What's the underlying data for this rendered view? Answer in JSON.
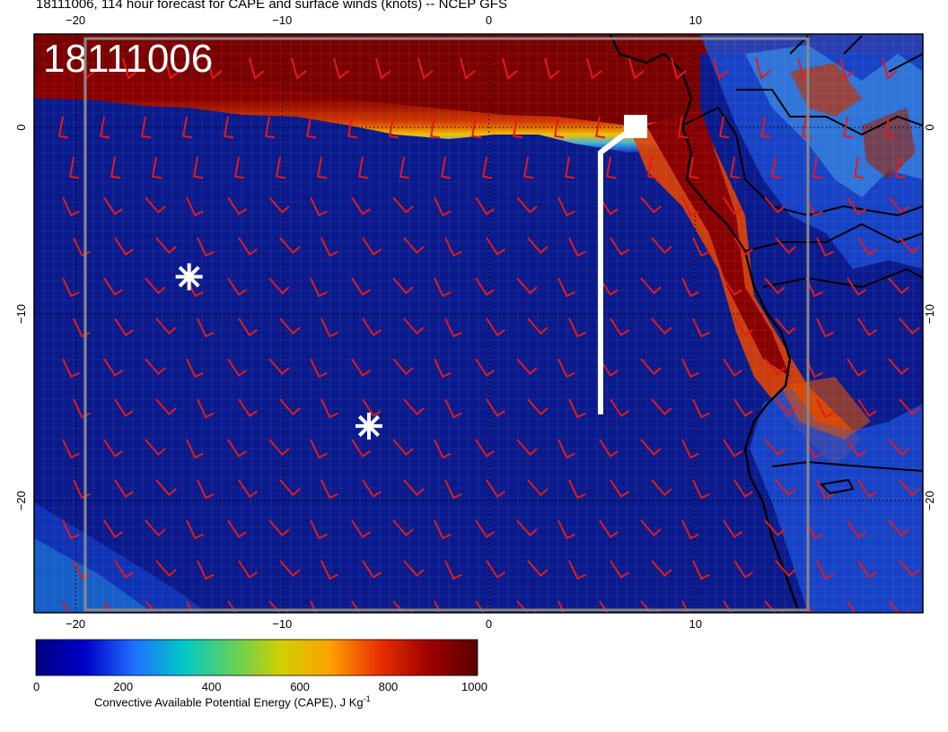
{
  "title": "18111006, 114 hour forecast for CAPE and surface winds (knots) -- NCEP GFS",
  "stamp": "18111006",
  "colors": {
    "ocean_low": "#0a1a8c",
    "high": "#7a0000",
    "barb": "#e31a1c",
    "coast": "#000000",
    "frame": "#808080",
    "marker": "#ffffff"
  },
  "axes": {
    "lon_ticks": [
      "−20",
      "−10",
      "0",
      "10"
    ],
    "lat_ticks": [
      "0",
      "−10",
      "−20"
    ]
  },
  "map": {
    "lon_range": [
      -22,
      21
    ],
    "lat_range": [
      -26,
      5
    ],
    "grid": "dotted",
    "markers": [
      {
        "name": "asterisk",
        "lon": -14.5,
        "lat": -8
      },
      {
        "name": "asterisk",
        "lon": -5.8,
        "lat": -16
      }
    ]
  },
  "colorbar": {
    "min": "0",
    "ticks": [
      "0",
      "200",
      "400",
      "600",
      "800",
      "1000"
    ],
    "label": "Convective Available Potential Energy (CAPE), J Kg",
    "label_sup": "-1",
    "stops": [
      "#00007f",
      "#0000c8",
      "#1f6fff",
      "#00c8c8",
      "#60d060",
      "#d0d000",
      "#ffa000",
      "#e83000",
      "#a00000",
      "#5a0000"
    ]
  }
}
